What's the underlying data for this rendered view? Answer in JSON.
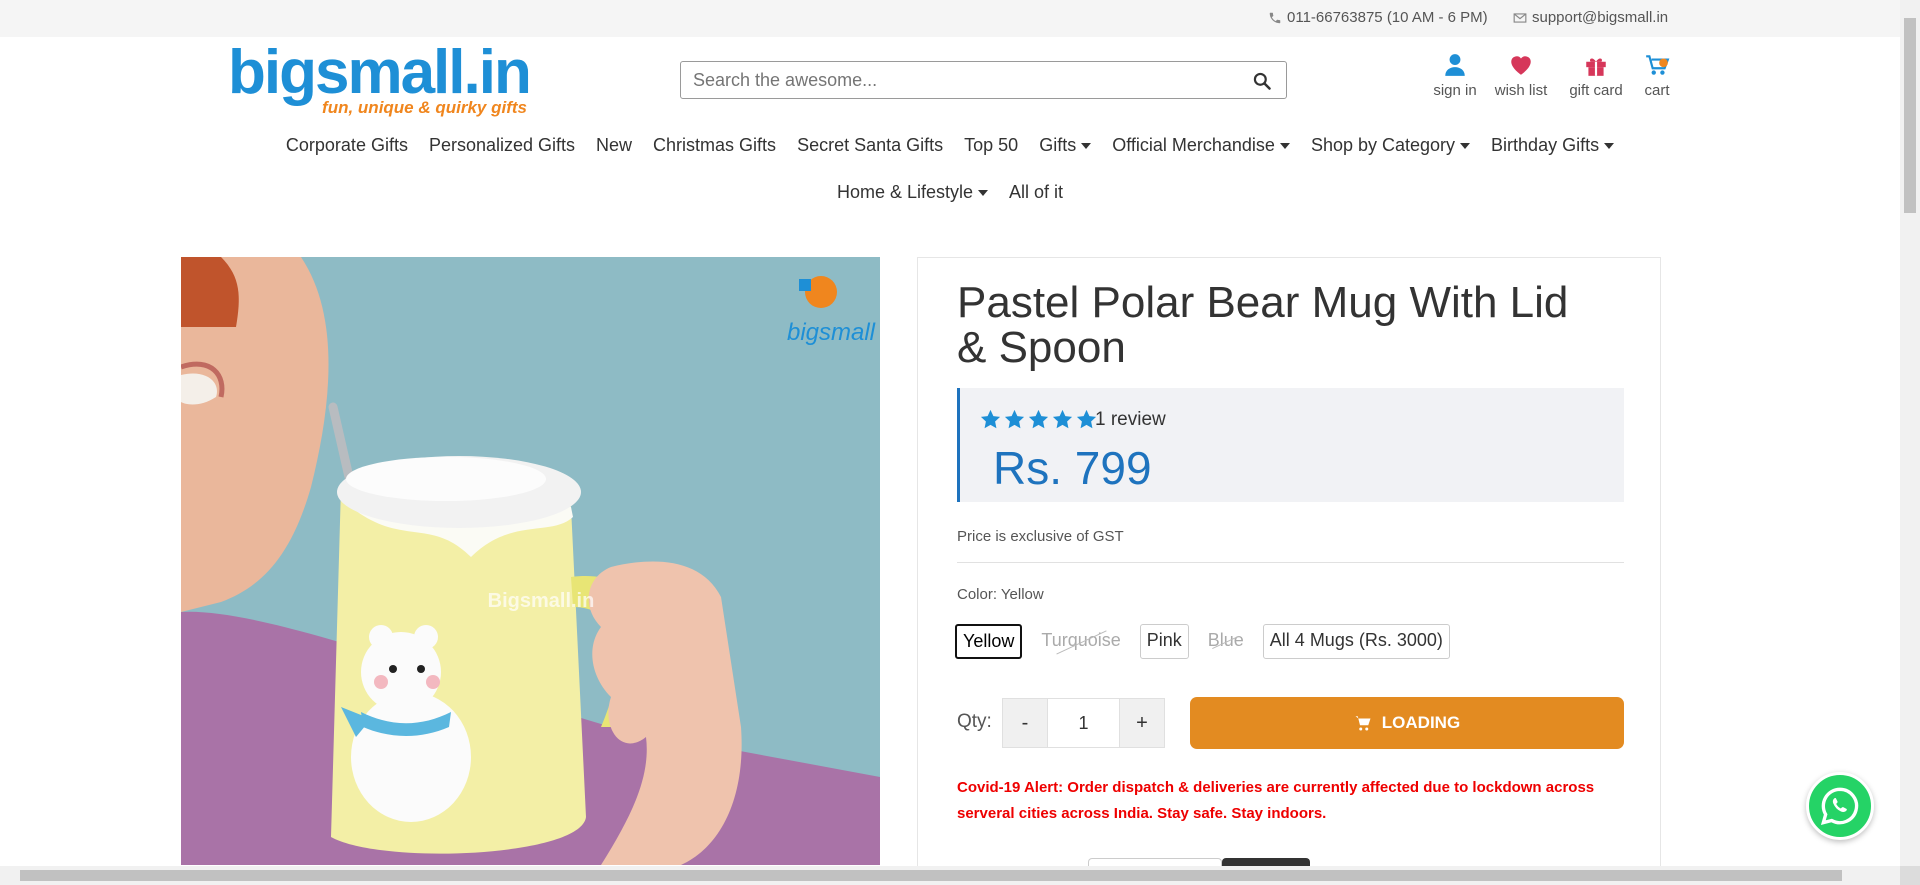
{
  "topbar": {
    "phone": "011-66763875 (10 AM - 6 PM)",
    "email": "support@bigsmall.in"
  },
  "brand": {
    "logo_text": "bigsmall.in",
    "tagline": "fun, unique & quirky gifts",
    "primary_color": "#1e8fd6",
    "accent_color": "#f0861e"
  },
  "search": {
    "placeholder": "Search the awesome..."
  },
  "header_icons": {
    "sign_in": "sign in",
    "wish_list": "wish list",
    "gift_card": "gift card",
    "cart": "cart"
  },
  "nav": {
    "row1": [
      {
        "label": "Corporate Gifts",
        "dropdown": false
      },
      {
        "label": "Personalized Gifts",
        "dropdown": false
      },
      {
        "label": "New",
        "dropdown": false
      },
      {
        "label": "Christmas Gifts",
        "dropdown": false
      },
      {
        "label": "Secret Santa Gifts",
        "dropdown": false
      },
      {
        "label": "Top 50",
        "dropdown": false
      },
      {
        "label": "Gifts",
        "dropdown": true
      },
      {
        "label": "Official Merchandise",
        "dropdown": true
      },
      {
        "label": "Shop by Category",
        "dropdown": true
      },
      {
        "label": "Birthday Gifts",
        "dropdown": true
      }
    ],
    "row2": [
      {
        "label": "Home & Lifestyle",
        "dropdown": true
      },
      {
        "label": "All of it",
        "dropdown": false
      }
    ]
  },
  "product": {
    "image_watermark": "Bigsmall.in",
    "image_logo_text": "bigsmall",
    "title": "Pastel Polar Bear Mug With Lid & Spoon",
    "rating": 5,
    "review_count": "1 review",
    "price": "Rs. 799",
    "gst_note": "Price is exclusive of GST",
    "color_label": "Color: Yellow",
    "colors": [
      {
        "label": "Yellow",
        "state": "selected"
      },
      {
        "label": "Turquoise",
        "state": "disabled"
      },
      {
        "label": "Pink",
        "state": "available"
      },
      {
        "label": "Blue",
        "state": "disabled"
      },
      {
        "label": "All 4 Mugs (Rs. 3000)",
        "state": "available"
      }
    ],
    "qty_label": "Qty:",
    "qty_minus": "-",
    "qty_value": "1",
    "qty_plus": "+",
    "add_to_cart": "LOADING",
    "alert": "Covid-19 Alert: Order dispatch & deliveries are currently affected due to lockdown across serveral cities across India. Stay safe. Stay indoors."
  }
}
